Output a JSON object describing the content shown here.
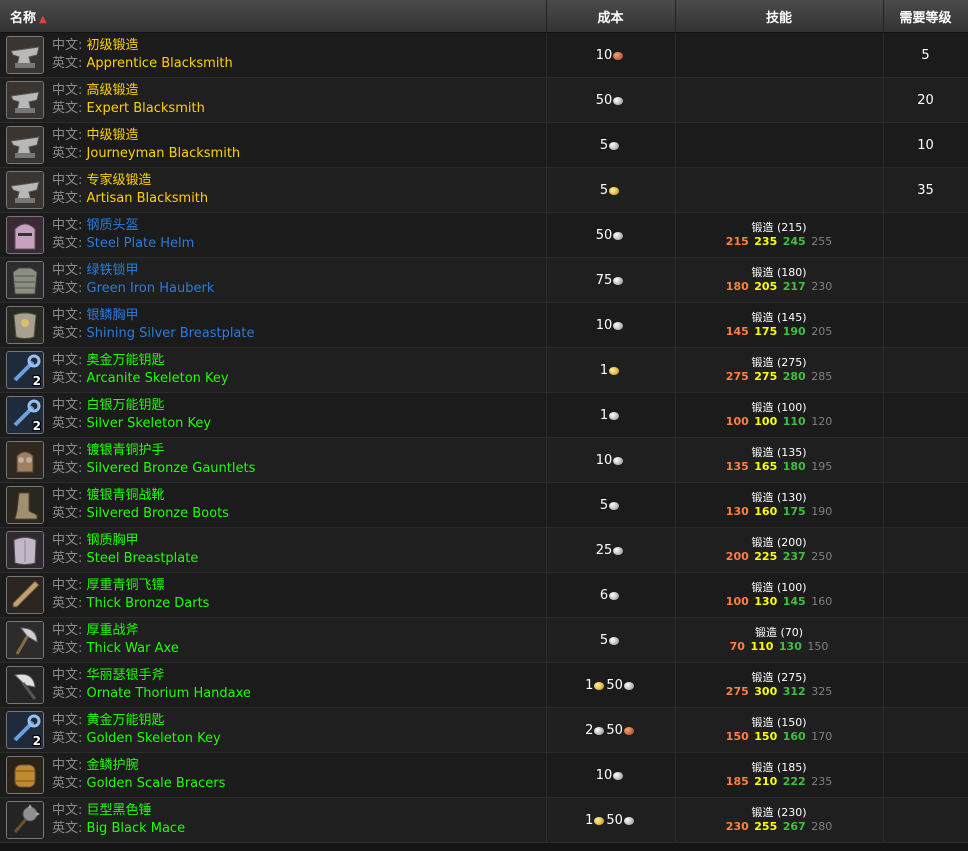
{
  "header": {
    "name": "名称",
    "sort_icon": "sort-up-icon",
    "cost": "成本",
    "skill": "技能",
    "level": "需要等级"
  },
  "labels": {
    "cn": "中文:",
    "en": "英文:"
  },
  "colors": {
    "yellow": "#ffd100",
    "blue": "#2b7bdc",
    "green": "#1eff00"
  },
  "rows": [
    {
      "icon": "anvil-icon",
      "qty": "",
      "cn": "初级锻造",
      "en": "Apprentice Blacksmith",
      "color": "ylw",
      "cost": [
        {
          "amt": "10",
          "coin": "copper"
        }
      ],
      "skill": null,
      "level": "5"
    },
    {
      "icon": "anvil-icon",
      "qty": "",
      "cn": "高级锻造",
      "en": "Expert Blacksmith",
      "color": "ylw",
      "cost": [
        {
          "amt": "50",
          "coin": "silver"
        }
      ],
      "skill": null,
      "level": "20"
    },
    {
      "icon": "anvil-icon",
      "qty": "",
      "cn": "中级锻造",
      "en": "Journeyman Blacksmith",
      "color": "ylw",
      "cost": [
        {
          "amt": "5",
          "coin": "silver"
        }
      ],
      "skill": null,
      "level": "10"
    },
    {
      "icon": "anvil-icon",
      "qty": "",
      "cn": "专家级锻造",
      "en": "Artisan Blacksmith",
      "color": "ylw",
      "cost": [
        {
          "amt": "5",
          "coin": "gold"
        }
      ],
      "skill": null,
      "level": "35"
    },
    {
      "icon": "helm-icon",
      "qty": "",
      "cn": "钢质头盔",
      "en": "Steel Plate Helm",
      "color": "blu",
      "cost": [
        {
          "amt": "50",
          "coin": "silver"
        }
      ],
      "skill": {
        "name": "锻造",
        "req": "(215)",
        "o": "215",
        "y": "235",
        "g": "245",
        "gr": "255"
      },
      "level": ""
    },
    {
      "icon": "chainmail-icon",
      "qty": "",
      "cn": "绿铁锁甲",
      "en": "Green Iron Hauberk",
      "color": "blu",
      "cost": [
        {
          "amt": "75",
          "coin": "silver"
        }
      ],
      "skill": {
        "name": "锻造",
        "req": "(180)",
        "o": "180",
        "y": "205",
        "g": "217",
        "gr": "230"
      },
      "level": ""
    },
    {
      "icon": "breastplate-icon",
      "qty": "",
      "cn": "银鳞胸甲",
      "en": "Shining Silver Breastplate",
      "color": "blu",
      "cost": [
        {
          "amt": "10",
          "coin": "silver"
        }
      ],
      "skill": {
        "name": "锻造",
        "req": "(145)",
        "o": "145",
        "y": "175",
        "g": "190",
        "gr": "205"
      },
      "level": ""
    },
    {
      "icon": "key-icon",
      "qty": "2",
      "cn": "奥金万能钥匙",
      "en": "Arcanite Skeleton Key",
      "color": "grn",
      "cost": [
        {
          "amt": "1",
          "coin": "gold"
        }
      ],
      "skill": {
        "name": "锻造",
        "req": "(275)",
        "o": "275",
        "y": "275",
        "g": "280",
        "gr": "285"
      },
      "level": ""
    },
    {
      "icon": "key-icon",
      "qty": "2",
      "cn": "白银万能钥匙",
      "en": "Silver Skeleton Key",
      "color": "grn",
      "cost": [
        {
          "amt": "1",
          "coin": "silver"
        }
      ],
      "skill": {
        "name": "锻造",
        "req": "(100)",
        "o": "100",
        "y": "100",
        "g": "110",
        "gr": "120"
      },
      "level": ""
    },
    {
      "icon": "gauntlets-icon",
      "qty": "",
      "cn": "镀银青铜护手",
      "en": "Silvered Bronze Gauntlets",
      "color": "grn",
      "cost": [
        {
          "amt": "10",
          "coin": "silver"
        }
      ],
      "skill": {
        "name": "锻造",
        "req": "(135)",
        "o": "135",
        "y": "165",
        "g": "180",
        "gr": "195"
      },
      "level": ""
    },
    {
      "icon": "boots-icon",
      "qty": "",
      "cn": "镀银青铜战靴",
      "en": "Silvered Bronze Boots",
      "color": "grn",
      "cost": [
        {
          "amt": "5",
          "coin": "silver"
        }
      ],
      "skill": {
        "name": "锻造",
        "req": "(130)",
        "o": "130",
        "y": "160",
        "g": "175",
        "gr": "190"
      },
      "level": ""
    },
    {
      "icon": "chestplate-icon",
      "qty": "",
      "cn": "钢质胸甲",
      "en": "Steel Breastplate",
      "color": "grn",
      "cost": [
        {
          "amt": "25",
          "coin": "silver"
        }
      ],
      "skill": {
        "name": "锻造",
        "req": "(200)",
        "o": "200",
        "y": "225",
        "g": "237",
        "gr": "250"
      },
      "level": ""
    },
    {
      "icon": "dart-icon",
      "qty": "",
      "cn": "厚重青铜飞镖",
      "en": "Thick Bronze Darts",
      "color": "grn",
      "cost": [
        {
          "amt": "6",
          "coin": "silver"
        }
      ],
      "skill": {
        "name": "锻造",
        "req": "(100)",
        "o": "100",
        "y": "130",
        "g": "145",
        "gr": "160"
      },
      "level": ""
    },
    {
      "icon": "axe-icon",
      "qty": "",
      "cn": "厚重战斧",
      "en": "Thick War Axe",
      "color": "grn",
      "cost": [
        {
          "amt": "5",
          "coin": "silver"
        }
      ],
      "skill": {
        "name": "锻造",
        "req": "(70)",
        "o": "70",
        "y": "110",
        "g": "130",
        "gr": "150"
      },
      "level": ""
    },
    {
      "icon": "handaxe-icon",
      "qty": "",
      "cn": "华丽瑟银手斧",
      "en": "Ornate Thorium Handaxe",
      "color": "grn",
      "cost": [
        {
          "amt": "1",
          "coin": "gold"
        },
        {
          "amt": "50",
          "coin": "silver"
        }
      ],
      "skill": {
        "name": "锻造",
        "req": "(275)",
        "o": "275",
        "y": "300",
        "g": "312",
        "gr": "325"
      },
      "level": ""
    },
    {
      "icon": "key-icon",
      "qty": "2",
      "cn": "黄金万能钥匙",
      "en": "Golden Skeleton Key",
      "color": "grn",
      "cost": [
        {
          "amt": "2",
          "coin": "silver"
        },
        {
          "amt": "50",
          "coin": "copper"
        }
      ],
      "skill": {
        "name": "锻造",
        "req": "(150)",
        "o": "150",
        "y": "150",
        "g": "160",
        "gr": "170"
      },
      "level": ""
    },
    {
      "icon": "bracers-icon",
      "qty": "",
      "cn": "金鳞护腕",
      "en": "Golden Scale Bracers",
      "color": "grn",
      "cost": [
        {
          "amt": "10",
          "coin": "silver"
        }
      ],
      "skill": {
        "name": "锻造",
        "req": "(185)",
        "o": "185",
        "y": "210",
        "g": "222",
        "gr": "235"
      },
      "level": ""
    },
    {
      "icon": "mace-icon",
      "qty": "",
      "cn": "巨型黑色锤",
      "en": "Big Black Mace",
      "color": "grn",
      "cost": [
        {
          "amt": "1",
          "coin": "gold"
        },
        {
          "amt": "50",
          "coin": "silver"
        }
      ],
      "skill": {
        "name": "锻造",
        "req": "(230)",
        "o": "230",
        "y": "255",
        "g": "267",
        "gr": "280"
      },
      "level": ""
    }
  ]
}
